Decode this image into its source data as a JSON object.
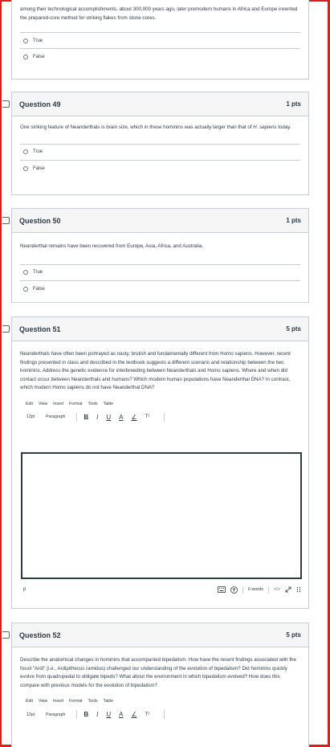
{
  "top_card": {
    "text": "among their technological accomplishments, about 300,000 years ago, later premodern humans in Africa and Europe invented the prepared-core method for striking flakes from stone cores.",
    "answers": [
      "True",
      "False"
    ]
  },
  "q49": {
    "title": "Question 49",
    "points": "1 pts",
    "text_before": "One striking feature of Neanderthals is brain size, which in these hominins was actually larger than that of ",
    "text_italic": "H. sapiens",
    "text_after": " today.",
    "answers": [
      "True",
      "False"
    ]
  },
  "q50": {
    "title": "Question 50",
    "points": "1 pts",
    "text": "Neanderthal remains have been recovered from Europe, Asia, Africa, and Australia.",
    "answers": [
      "True",
      "False"
    ]
  },
  "q51": {
    "title": "Question 51",
    "points": "5 pts",
    "text": "Neanderthals have often been portrayed as nasty, brutish and fundamentally different from Homo sapiens. However, recent findings presented in class and described in the textbook suggests a different scenario and relationship between the two hominins. Address the genetic evidence for interbreeding between Neanderthals and Homo sapiens. Where and when did contact occur between Neanderthals and humans? Which modern human populations have Neanderthal DNA? In contrast, which modern Homo sapiens do not have Neanderthal DNA?",
    "status_path": "p",
    "word_count": "0 words",
    "code_toggle": "</>"
  },
  "q52": {
    "title": "Question 52",
    "points": "5 pts",
    "text": "Describe the anatomical changes in hominins that accompanied bipedalism.  How have the recent findings associated with the fossil \"Ardi\" (i.e., Ardipithecus ramidus) challenged our understanding of the evolution of bipedalism? Did hominins quickly evolve from quadrupedal to obligate bipeds? What about the environment in which bipedalism evolved?  How does this compare with previous models for the evolution of bipedalism?"
  },
  "editor": {
    "menu": [
      "Edit",
      "View",
      "Insert",
      "Format",
      "Tools",
      "Table"
    ],
    "font_size": "12pt",
    "block_format": "Paragraph",
    "bold": "B",
    "italic": "I",
    "underline": "U",
    "text_color": "A",
    "highlight": "∠",
    "superscript": "T²"
  },
  "colors": {
    "frame": "#e21b1b",
    "border": "#c7cdd1",
    "header_bg": "#f5f5f5",
    "text": "#2d3b45"
  }
}
